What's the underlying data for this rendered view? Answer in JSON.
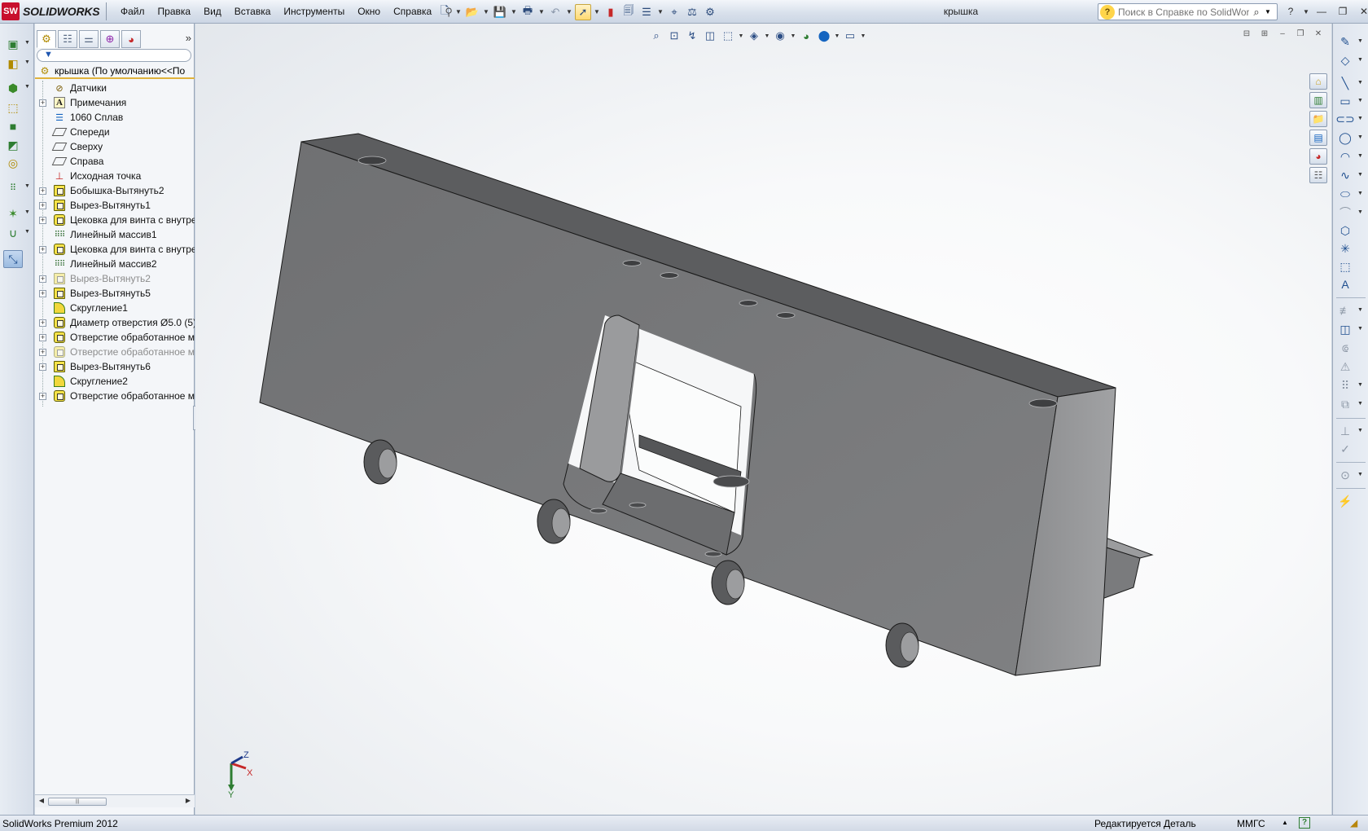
{
  "app": {
    "logo_badge": "SW",
    "logo_text": "SOLIDWORKS",
    "document_title": "крышка"
  },
  "menu": [
    "Файл",
    "Правка",
    "Вид",
    "Вставка",
    "Инструменты",
    "Окно",
    "Справка"
  ],
  "search": {
    "placeholder": "Поиск в Справке по SolidWorks"
  },
  "feature_manager": {
    "root_label": "крышка  (По умолчанию<<По",
    "items": [
      {
        "label": "Датчики",
        "expandable": false,
        "icon": "sensor-icon",
        "suppressed": false
      },
      {
        "label": "Примечания",
        "expandable": true,
        "icon": "annotations-icon",
        "suppressed": false
      },
      {
        "label": "1060 Сплав",
        "expandable": false,
        "icon": "material-icon",
        "suppressed": false
      },
      {
        "label": "Спереди",
        "expandable": false,
        "icon": "plane-icon",
        "suppressed": false
      },
      {
        "label": "Сверху",
        "expandable": false,
        "icon": "plane-icon",
        "suppressed": false
      },
      {
        "label": "Справа",
        "expandable": false,
        "icon": "plane-icon",
        "suppressed": false
      },
      {
        "label": "Исходная точка",
        "expandable": false,
        "icon": "origin-icon",
        "suppressed": false
      },
      {
        "label": "Бобышка-Вытянуть2",
        "expandable": true,
        "icon": "extrude-boss-icon",
        "suppressed": false
      },
      {
        "label": "Вырез-Вытянуть1",
        "expandable": true,
        "icon": "extrude-cut-icon",
        "suppressed": false
      },
      {
        "label": "Цековка для винта с внутре",
        "expandable": true,
        "icon": "hole-wizard-icon",
        "suppressed": false
      },
      {
        "label": "Линейный массив1",
        "expandable": false,
        "icon": "linear-pattern-icon",
        "suppressed": false
      },
      {
        "label": "Цековка для винта с внутре",
        "expandable": true,
        "icon": "hole-wizard-icon",
        "suppressed": false
      },
      {
        "label": "Линейный массив2",
        "expandable": false,
        "icon": "linear-pattern-icon",
        "suppressed": false
      },
      {
        "label": "Вырез-Вытянуть2",
        "expandable": true,
        "icon": "extrude-cut-icon",
        "suppressed": true
      },
      {
        "label": "Вырез-Вытянуть5",
        "expandable": true,
        "icon": "extrude-cut-icon",
        "suppressed": false
      },
      {
        "label": "Скругление1",
        "expandable": false,
        "icon": "fillet-icon",
        "suppressed": false
      },
      {
        "label": "Диаметр отверстия Ø5.0 (5):",
        "expandable": true,
        "icon": "hole-wizard-icon",
        "suppressed": false
      },
      {
        "label": "Отверстие обработанное м",
        "expandable": true,
        "icon": "hole-wizard-icon",
        "suppressed": false
      },
      {
        "label": "Отверстие обработанное м",
        "expandable": true,
        "icon": "hole-wizard-icon",
        "suppressed": true
      },
      {
        "label": "Вырез-Вытянуть6",
        "expandable": true,
        "icon": "extrude-cut-icon",
        "suppressed": false
      },
      {
        "label": "Скругление2",
        "expandable": false,
        "icon": "fillet-icon",
        "suppressed": false
      },
      {
        "label": "Отверстие обработанное м",
        "expandable": true,
        "icon": "hole-wizard-icon",
        "suppressed": false
      }
    ]
  },
  "triad": {
    "x": "X",
    "y": "Y",
    "z": "Z"
  },
  "status": {
    "product": "SolidWorks Premium 2012",
    "mode": "Редактируется Деталь",
    "units": "ММГС"
  },
  "colors": {
    "model_face": "#7b7c7e",
    "model_top": "#5d5e60",
    "model_side": "#9a9b9d",
    "background": "#f5f6f8"
  }
}
